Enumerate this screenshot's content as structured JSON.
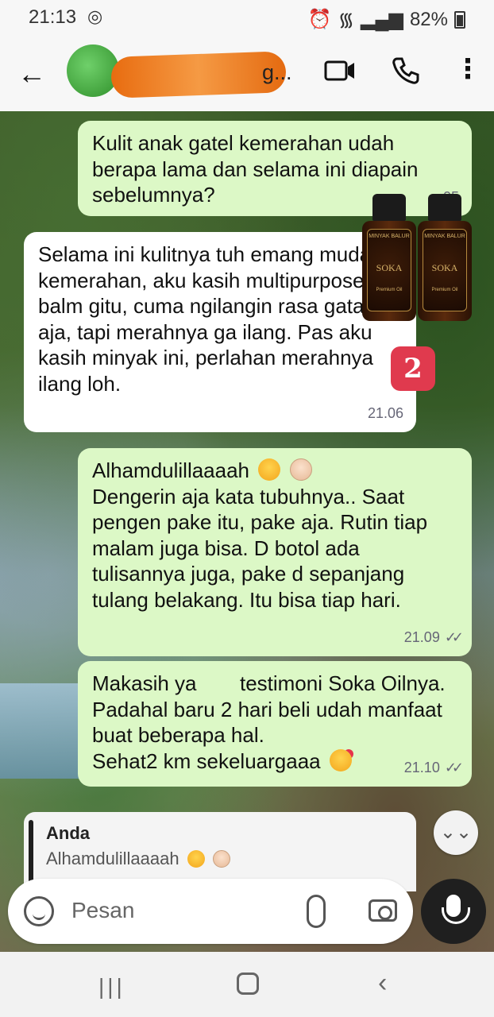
{
  "status_bar": {
    "time": "21:13",
    "battery": "82%"
  },
  "header": {
    "contact_name": "g...",
    "icons": [
      "back-arrow-icon",
      "video-call-icon",
      "voice-call-icon",
      "more-vert-icon"
    ]
  },
  "messages": [
    {
      "direction": "out",
      "text": "Kulit anak gatel kemerahan udah berapa lama dan selama ini diapain sebelumnya?",
      "time": ".05"
    },
    {
      "direction": "in",
      "text": "Selama ini kulitnya tuh emang mudah kemerahan, aku kasih multipurpose balm gitu, cuma ngilangin rasa gatal aja, tapi merahnya ga ilang. Pas aku kasih minyak ini, perlahan merahnya ilang loh.",
      "time": "21.06"
    },
    {
      "direction": "out",
      "text_first": "Alhamdulillaaaah",
      "text": "Dengerin aja kata tubuhnya.. Saat pengen pake itu, pake aja. Rutin tiap malam juga bisa. D botol ada tulisannya juga, pake d sepanjang tulang belakang. Itu bisa tiap hari.",
      "time": "21.09"
    },
    {
      "direction": "out",
      "text": "Makasih ya",
      "text_b": "testimoni Soka Oilnya. Padahal baru 2 hari beli udah manfaat buat beberapa hal.",
      "text_c": "Sehat2 km sekeluargaaa",
      "time": "21.10"
    }
  ],
  "product_overlay": {
    "bottle_brand": "MINYAK BALUR",
    "bottle_name": "SOKA",
    "bottle_sub": "Premium Oil",
    "badge": "2"
  },
  "reply_preview": {
    "author": "Anda",
    "quote": "Alhamdulillaaaah"
  },
  "input": {
    "placeholder": "Pesan"
  },
  "colors": {
    "outgoing_bubble": "#dcf8c6",
    "incoming_bubble": "#ffffff",
    "badge": "#e03a4e"
  }
}
